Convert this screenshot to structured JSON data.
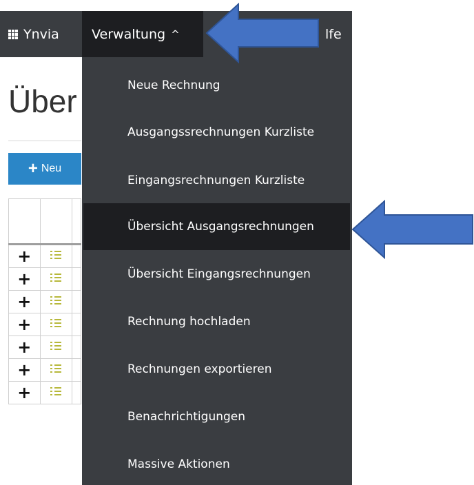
{
  "navbar": {
    "brand_label": "Ynvia",
    "brand_icon": "grid-icon",
    "admin_label": "Verwaltung",
    "admin_caret": "^",
    "help_label_partial": "lfe"
  },
  "page": {
    "title_partial": "Über",
    "new_button_label": "Neu",
    "new_button_icon": "plus-icon",
    "rows": [
      {
        "expand": "+",
        "icon": "list-icon"
      },
      {
        "expand": "+",
        "icon": "list-icon"
      },
      {
        "expand": "+",
        "icon": "list-icon"
      },
      {
        "expand": "+",
        "icon": "list-icon"
      },
      {
        "expand": "+",
        "icon": "list-icon"
      },
      {
        "expand": "+",
        "icon": "list-icon"
      },
      {
        "expand": "+",
        "icon": "list-icon"
      }
    ]
  },
  "menu": {
    "items": [
      {
        "label": "Neue Rechnung"
      },
      {
        "label": "Ausgangssrechnungen Kurzliste"
      },
      {
        "label": "Eingangsrechnungen Kurzliste"
      },
      {
        "label": "Übersicht Ausgangsrechnungen"
      },
      {
        "label": "Übersicht Eingangsrechnungen"
      },
      {
        "label": "Rechnung hochladen"
      },
      {
        "label": "Rechnungen exportieren"
      },
      {
        "label": "Benachrichtigungen"
      },
      {
        "label": "Massive Aktionen"
      }
    ],
    "active_index": 3
  },
  "annotations": {
    "arrow_color": "#4472c4",
    "arrow_stroke": "#2f5597"
  },
  "colors": {
    "navbar_bg": "#3a3d41",
    "active_bg": "#1d1e21",
    "button_blue": "#2b86c7"
  }
}
